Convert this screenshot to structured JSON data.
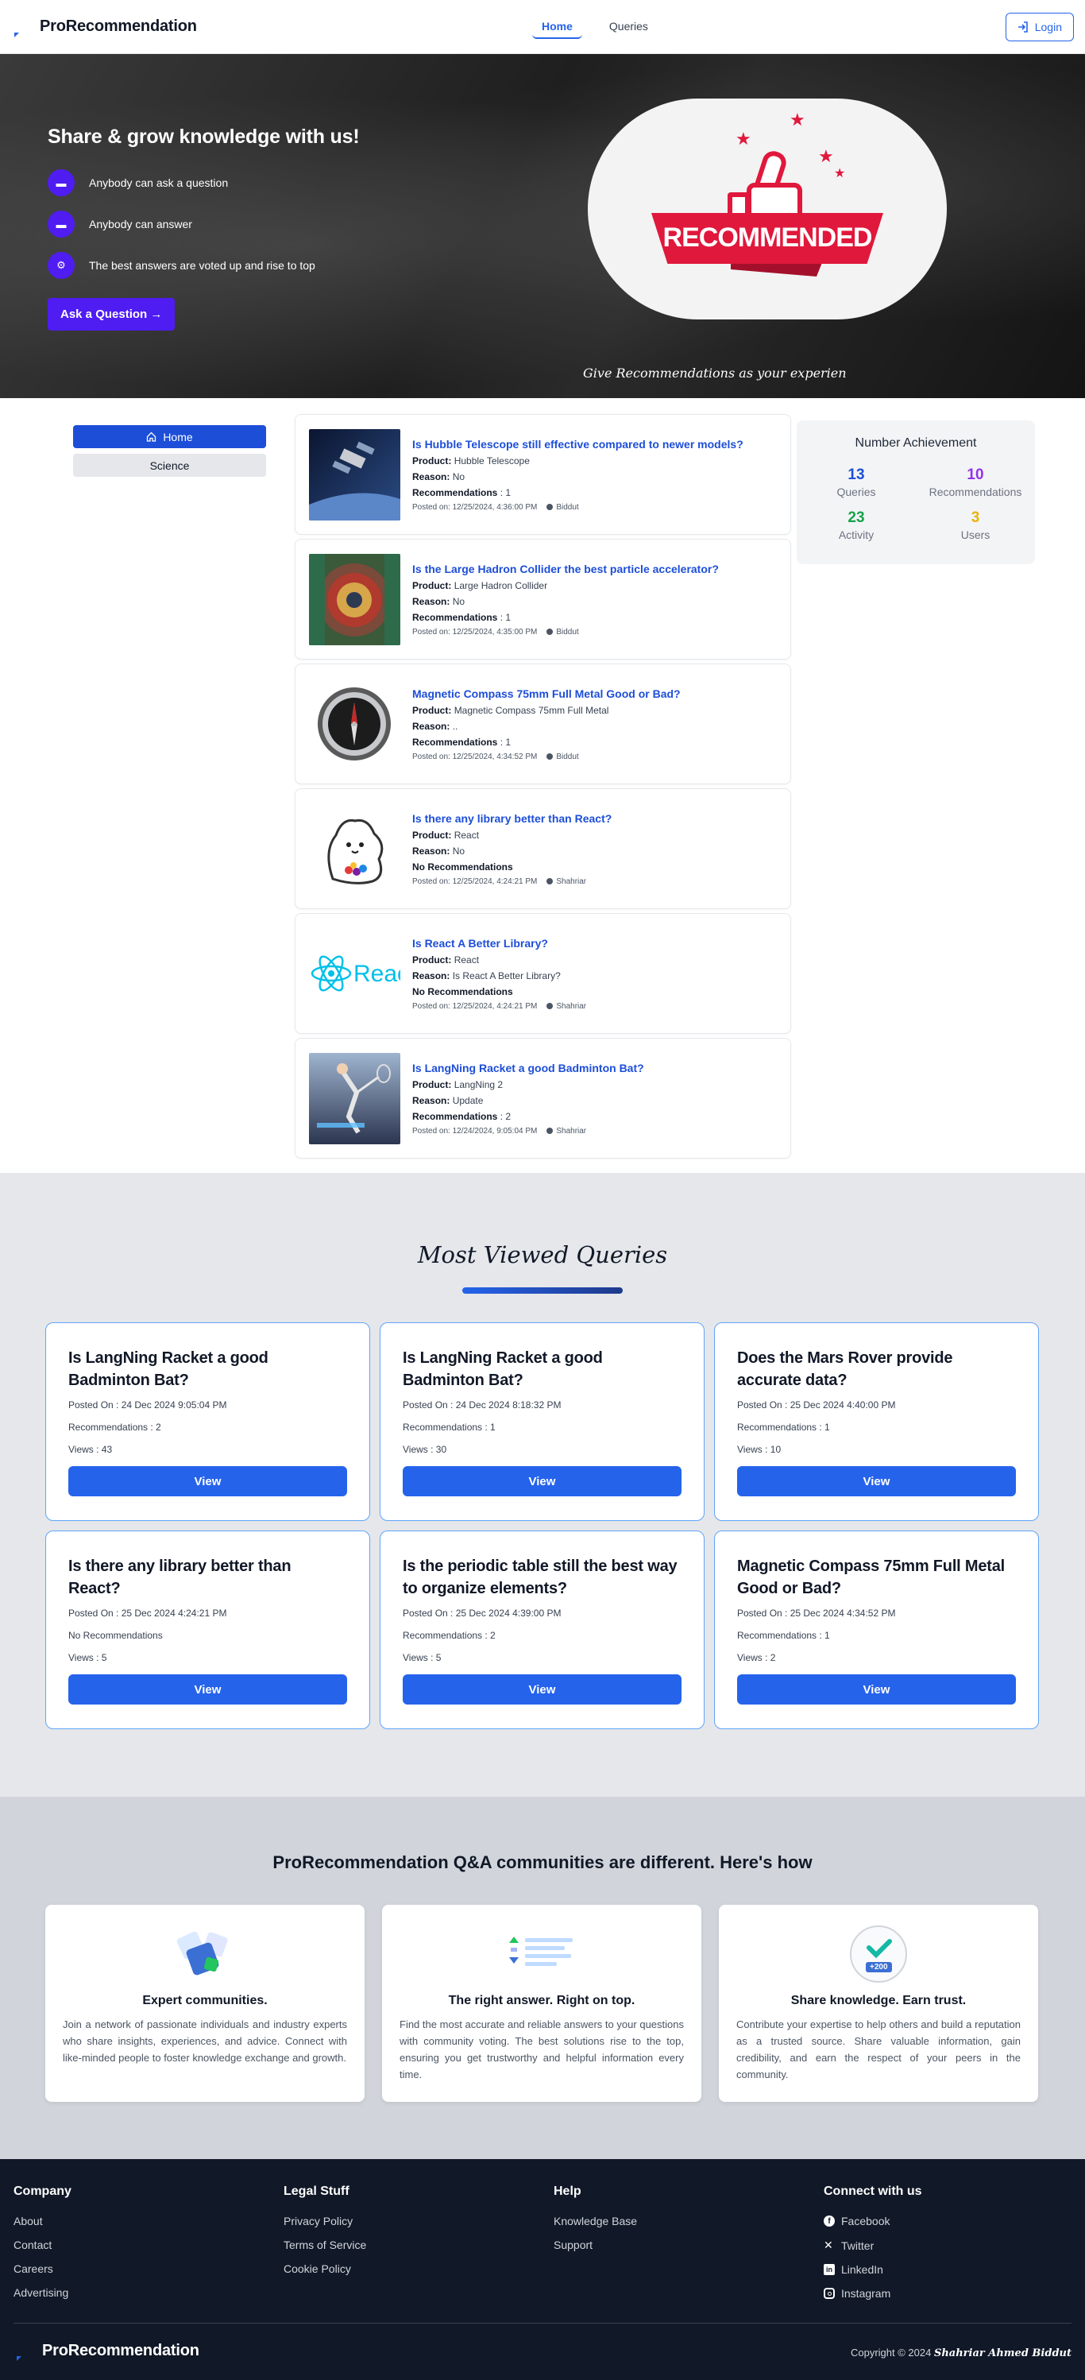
{
  "brand": {
    "name": "ProRecommendation"
  },
  "nav": {
    "home": "Home",
    "queries": "Queries",
    "login": "Login"
  },
  "hero": {
    "title": "Share & grow knowledge with us!",
    "items": [
      {
        "icon": "chat-icon",
        "text": "Anybody can ask a question"
      },
      {
        "icon": "chat-icon",
        "text": "Anybody can answer"
      },
      {
        "icon": "gear-icon",
        "text": "The best answers are voted up and rise to top"
      }
    ],
    "cta": "Ask a Question →",
    "badge_text": "RECOMMENDED",
    "caption": "Give Recommendations as your experien"
  },
  "sidebar": {
    "items": [
      "Home",
      "Science"
    ]
  },
  "posts": [
    {
      "title": "Is Hubble Telescope still effective compared to newer models?",
      "product_label": "Product:",
      "product": "Hubble Telescope",
      "reason_label": "Reason:",
      "reason": "No",
      "recs_label": "Recommendations",
      "recs": ": 1",
      "posted": "Posted on: 12/25/2024, 4:36:00 PM",
      "author": "Biddut"
    },
    {
      "title": "Is the Large Hadron Collider the best particle accelerator?",
      "product_label": "Product:",
      "product": "Large Hadron Collider",
      "reason_label": "Reason:",
      "reason": "No",
      "recs_label": "Recommendations",
      "recs": ": 1",
      "posted": "Posted on: 12/25/2024, 4:35:00 PM",
      "author": "Biddut"
    },
    {
      "title": "Magnetic Compass 75mm Full Metal Good or Bad?",
      "product_label": "Product:",
      "product": "Magnetic Compass 75mm Full Metal",
      "reason_label": "Reason:",
      "reason": "..",
      "recs_label": "Recommendations",
      "recs": ": 1",
      "posted": "Posted on: 12/25/2024, 4:34:52 PM",
      "author": "Biddut"
    },
    {
      "title": "Is there any library better than React?",
      "product_label": "Product:",
      "product": "React",
      "reason_label": "Reason:",
      "reason": "No",
      "recs_label": "No Recommendations",
      "recs": "",
      "posted": "Posted on: 12/25/2024, 4:24:21 PM",
      "author": "Shahriar"
    },
    {
      "title": "Is React A Better Library?",
      "product_label": "Product:",
      "product": "React",
      "reason_label": "Reason:",
      "reason": "Is React A Better Library?",
      "recs_label": "No Recommendations",
      "recs": "",
      "posted": "Posted on: 12/25/2024, 4:24:21 PM",
      "author": "Shahriar"
    },
    {
      "title": "Is LangNing Racket a good Badminton Bat?",
      "product_label": "Product:",
      "product": "LangNing 2",
      "reason_label": "Reason:",
      "reason": "Update",
      "recs_label": "Recommendations",
      "recs": ": 2",
      "posted": "Posted on: 12/24/2024, 9:05:04 PM",
      "author": "Shahriar"
    }
  ],
  "achievement": {
    "title": "Number Achievement",
    "stats": [
      {
        "value": "13",
        "label": "Queries",
        "color": "#1d4ed8"
      },
      {
        "value": "10",
        "label": "Recommendations",
        "color": "#9333ea"
      },
      {
        "value": "23",
        "label": "Activity",
        "color": "#16a34a"
      },
      {
        "value": "3",
        "label": "Users",
        "color": "#eab308"
      }
    ]
  },
  "most_viewed": {
    "title": "Most Viewed Queries",
    "cards": [
      {
        "title": "Is LangNing Racket a good Badminton Bat?",
        "posted": "Posted On : 24 Dec 2024 9:05:04 PM",
        "recs": "Recommendations : 2",
        "views": "Views : 43",
        "button": "View"
      },
      {
        "title": "Is LangNing Racket a good Badminton Bat?",
        "posted": "Posted On : 24 Dec 2024 8:18:32 PM",
        "recs": "Recommendations : 1",
        "views": "Views : 30",
        "button": "View"
      },
      {
        "title": "Does the Mars Rover provide accurate data?",
        "posted": "Posted On : 25 Dec 2024 4:40:00 PM",
        "recs": "Recommendations : 1",
        "views": "Views : 10",
        "button": "View"
      },
      {
        "title": "Is there any library better than React?",
        "posted": "Posted On : 25 Dec 2024 4:24:21 PM",
        "recs": "No Recommendations",
        "views": "Views : 5",
        "button": "View"
      },
      {
        "title": "Is the periodic table still the best way to organize elements?",
        "posted": "Posted On : 25 Dec 2024 4:39:00 PM",
        "recs": "Recommendations : 2",
        "views": "Views : 5",
        "button": "View"
      },
      {
        "title": "Magnetic Compass 75mm Full Metal Good or Bad?",
        "posted": "Posted On : 25 Dec 2024 4:34:52 PM",
        "recs": "Recommendations : 1",
        "views": "Views : 2",
        "button": "View"
      }
    ]
  },
  "communities": {
    "title": "ProRecommendation Q&A communities are different. Here's how",
    "cards": [
      {
        "icon": "community-icon",
        "heading": "Expert communities.",
        "text": "Join a network of passionate individuals and industry experts who share insights, experiences, and advice. Connect with like-minded people to foster knowledge exchange and growth."
      },
      {
        "icon": "vote-icon",
        "heading": "The right answer. Right on top.",
        "text": "Find the most accurate and reliable answers to your questions with community voting. The best solutions rise to the top, ensuring you get trustworthy and helpful information every time."
      },
      {
        "icon": "trust-icon",
        "heading": "Share knowledge. Earn trust.",
        "text": "Contribute your expertise to help others and build a reputation as a trusted source. Share valuable information, gain credibility, and earn the respect of your peers in the community.",
        "badge": "+200"
      }
    ]
  },
  "footer": {
    "company": {
      "title": "Company",
      "links": [
        "About",
        "Contact",
        "Careers",
        "Advertising"
      ]
    },
    "legal": {
      "title": "Legal Stuff",
      "links": [
        "Privacy Policy",
        "Terms of Service",
        "Cookie Policy"
      ]
    },
    "help": {
      "title": "Help",
      "links": [
        "Knowledge Base",
        "Support"
      ]
    },
    "connect": {
      "title": "Connect with us",
      "links": [
        "Facebook",
        "Twitter",
        "LinkedIn",
        "Instagram"
      ]
    },
    "copyright": "Copyright © 2024",
    "author": "Shahriar Ahmed Biddut"
  }
}
